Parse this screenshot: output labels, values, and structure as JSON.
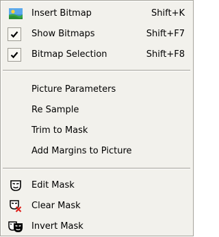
{
  "menu": {
    "groups": [
      {
        "items": [
          {
            "label": "Insert Bitmap",
            "shortcut": "Shift+K",
            "icon": "insert-bitmap-icon",
            "checked": false
          },
          {
            "label": "Show Bitmaps",
            "shortcut": "Shift+F7",
            "icon": "",
            "checked": true
          },
          {
            "label": "Bitmap Selection",
            "shortcut": "Shift+F8",
            "icon": "",
            "checked": true
          }
        ]
      },
      {
        "items": [
          {
            "label": "Picture Parameters"
          },
          {
            "label": "Re Sample"
          },
          {
            "label": "Trim to Mask"
          },
          {
            "label": "Add Margins to Picture"
          }
        ]
      },
      {
        "items": [
          {
            "label": "Edit Mask",
            "icon": "edit-mask-icon"
          },
          {
            "label": "Clear Mask",
            "icon": "clear-mask-icon"
          },
          {
            "label": "Invert Mask",
            "icon": "invert-mask-icon"
          }
        ]
      }
    ]
  }
}
